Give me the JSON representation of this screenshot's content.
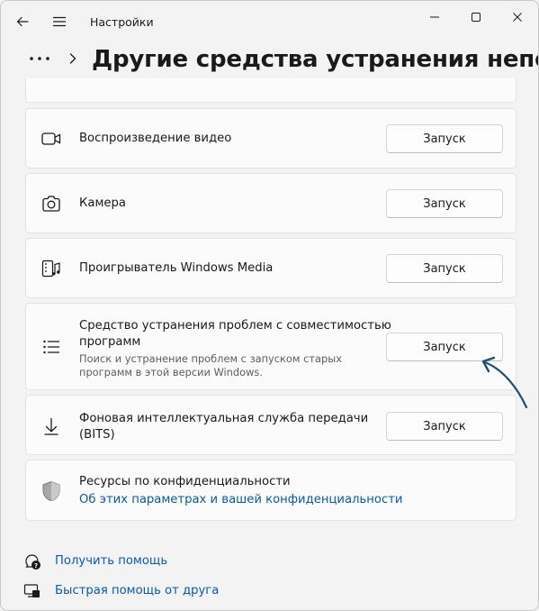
{
  "window": {
    "app_title": "Настройки"
  },
  "header": {
    "title": "Другие средства устранения неполадок"
  },
  "items": [
    {
      "label": "Воспроизведение видео",
      "button": "Запуск",
      "icon": "video-camera-icon"
    },
    {
      "label": "Камера",
      "button": "Запуск",
      "icon": "camera-icon"
    },
    {
      "label": "Проигрыватель Windows Media",
      "button": "Запуск",
      "icon": "media-player-icon"
    },
    {
      "label_line1": "Средство устранения проблем с совместимостью",
      "label_line2": "программ",
      "desc_line1": "Поиск и устранение проблем с запуском старых",
      "desc_line2": "программ в этой версии Windows.",
      "button": "Запуск",
      "icon": "list-icon"
    },
    {
      "label_line1": "Фоновая интеллектуальная служба передачи",
      "label_line2": "(BITS)",
      "button": "Запуск",
      "icon": "download-arrow-icon"
    }
  ],
  "privacy": {
    "title": "Ресурсы по конфиденциальности",
    "link": "Об этих параметрах и вашей конфиденциальности"
  },
  "help": {
    "get_help": "Получить помощь",
    "quick_assist": "Быстрая помощь от друга"
  },
  "colors": {
    "accent": "#0a5aa8",
    "background": "#f3f3f3",
    "card": "#fbfbfb",
    "annotation_arrow": "#1f4d7a"
  }
}
